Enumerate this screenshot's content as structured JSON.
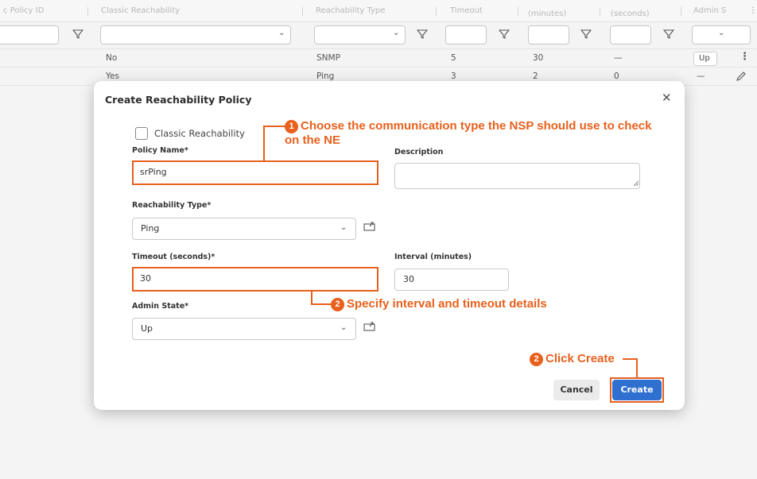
{
  "table": {
    "headers": [
      "c Policy ID",
      "Classic Reachability",
      "Reachability Type",
      "Timeout",
      "(minutes)",
      "(seconds)",
      "Admin S"
    ],
    "rows": [
      {
        "classic": "No",
        "type": "SNMP",
        "timeout": "5",
        "interval": "30",
        "retry": "—",
        "admin": "Up"
      },
      {
        "classic": "Yes",
        "type": "Ping",
        "timeout": "3",
        "interval": "2",
        "retry": "0",
        "admin": "—"
      }
    ]
  },
  "dialog": {
    "title": "Create Reachability Policy",
    "classic_label": "Classic Reachability",
    "policy_name_label": "Policy Name*",
    "policy_name_value": "srPing",
    "description_label": "Description",
    "reach_type_label": "Reachability Type*",
    "reach_type_value": "Ping",
    "timeout_label": "Timeout (seconds)*",
    "timeout_value": "30",
    "interval_label": "Interval (minutes)",
    "interval_value": "30",
    "admin_label": "Admin State*",
    "admin_value": "Up",
    "cancel": "Cancel",
    "create": "Create"
  },
  "callouts": {
    "c1_num": "1",
    "c1_text": "Choose the communication type the NSP should use to check on the NE",
    "c2_num": "2",
    "c2_text": "Specify interval and timeout details",
    "c3_num": "2",
    "c3_text": "Click Create"
  },
  "colors": {
    "accent": "#e8601c",
    "primary": "#2f6fcf"
  }
}
